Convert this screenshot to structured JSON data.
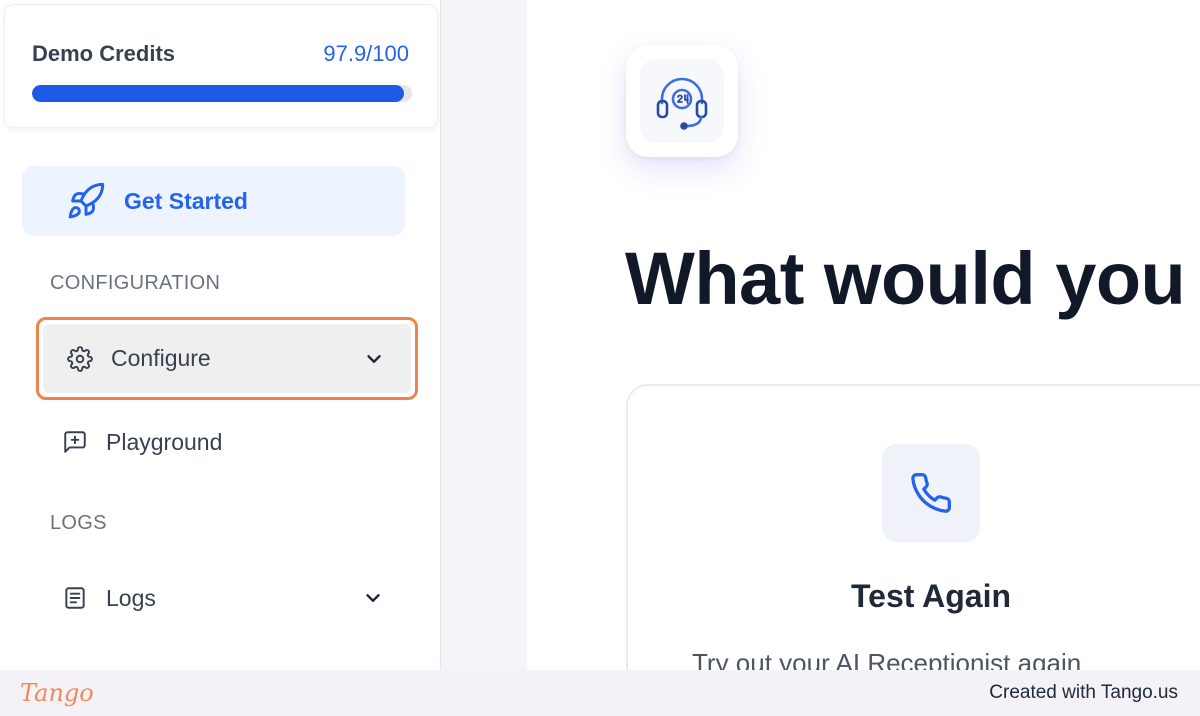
{
  "sidebar": {
    "credits": {
      "label": "Demo Credits",
      "value": "97.9/100",
      "progress_percent": 97.9
    },
    "get_started_label": "Get Started",
    "sections": {
      "configuration": "CONFIGURATION",
      "logs": "LOGS"
    },
    "items": {
      "configure": "Configure",
      "playground": "Playground",
      "logs": "Logs"
    }
  },
  "main": {
    "headline": "What would you",
    "option": {
      "title": "Test Again",
      "description": "Try out your AI Receptionist again"
    }
  },
  "footer": {
    "logo": "Tango",
    "text": "Created with Tango.us"
  },
  "colors": {
    "accent": "#2563eb",
    "highlight_border": "#f0824f",
    "tango_brand": "#f08a5d"
  },
  "icons": {
    "get_started": "rocket-icon",
    "configure": "gear-icon",
    "playground": "chat-plus-icon",
    "logs": "document-list-icon",
    "hero": "headset-24-icon",
    "option": "phone-icon",
    "chevron": "chevron-down-icon"
  }
}
